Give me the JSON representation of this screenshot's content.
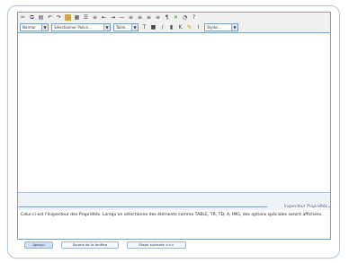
{
  "toolbar1": {
    "icons": [
      "cut-icon",
      "copy-icon",
      "paste-icon",
      "undo-icon",
      "redo-icon",
      "image-icon",
      "table-icon",
      "bullet-list-icon",
      "numbered-list-icon",
      "outdent-icon",
      "indent-icon",
      "horizontal-rule-icon",
      "align-left-icon",
      "align-center-icon",
      "align-right-icon",
      "justify-icon",
      "paragraph-icon",
      "clean-html-icon",
      "find-icon",
      "help-icon"
    ]
  },
  "toolbar2": {
    "format_select": "Normal",
    "font_select": "Sélectionner Police...",
    "size_select": "Taille...",
    "style_select": "Styles..."
  },
  "inspector": {
    "title": "Inspecteur Propriétés",
    "text": "Celui-ci est l'Inspecteur des Propriétés. Lorsqu'on sélectionne des éléments comme TABLE, TR, TD, A, IMG, des options spéciales seront affichées."
  },
  "tabs": [
    {
      "label": "Aperçu"
    },
    {
      "label": "Source de la fenêtre"
    },
    {
      "label": "Étape suivante >>>"
    }
  ]
}
